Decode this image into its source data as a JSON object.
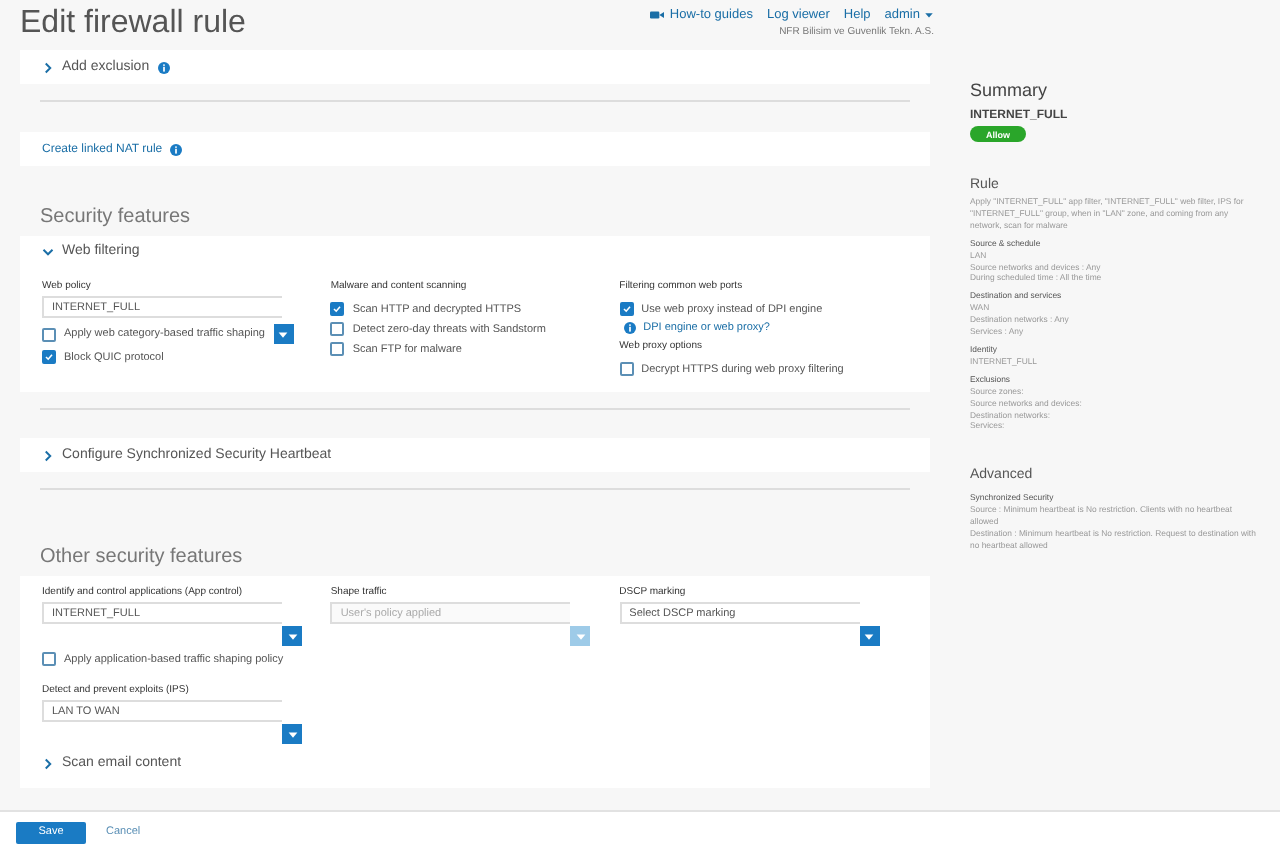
{
  "header": {
    "title": "Edit firewall rule",
    "links": [
      "How-to guides",
      "Log viewer",
      "Help"
    ],
    "user": "admin",
    "company": "NFR Bilisim ve Guvenlik Tekn. A.S."
  },
  "exclusion": {
    "label": "Add exclusion",
    "expanded": false
  },
  "nat": {
    "label": "Create linked NAT rule"
  },
  "security": {
    "heading": "Security features",
    "web_filtering": {
      "label": "Web filtering",
      "expanded": true,
      "web_policy": {
        "label": "Web policy",
        "value": "INTERNET_FULL"
      },
      "left_options": [
        {
          "label": "Apply web category-based traffic shaping",
          "checked": false,
          "dropdown": true
        },
        {
          "label": "Block QUIC protocol",
          "checked": true,
          "dropdown": false
        }
      ],
      "malware": {
        "label": "Malware and content scanning",
        "options": [
          {
            "label": "Scan HTTP and decrypted HTTPS",
            "checked": true
          },
          {
            "label": "Detect zero-day threats with Sandstorm",
            "checked": false
          },
          {
            "label": "Scan FTP for malware",
            "checked": false
          }
        ]
      },
      "ports": {
        "label": "Filtering common web ports",
        "option": {
          "label": "Use web proxy instead of DPI engine",
          "checked": true
        },
        "link": "DPI engine or web proxy?"
      },
      "proxy": {
        "label": "Web proxy options",
        "option": {
          "label": "Decrypt HTTPS during web proxy filtering",
          "checked": false
        }
      }
    },
    "heartbeat": {
      "label": "Configure Synchronized Security Heartbeat",
      "expanded": false
    }
  },
  "other": {
    "heading": "Other security features",
    "app_control": {
      "label": "Identify and control applications (App control)",
      "value": "INTERNET_FULL",
      "disabled": false
    },
    "shape_traffic": {
      "label": "Shape traffic",
      "placeholder": "User's policy applied",
      "disabled": true
    },
    "dscp": {
      "label": "DSCP marking",
      "value": "Select DSCP marking",
      "disabled": false
    },
    "app_shaping": {
      "label": "Apply application-based traffic shaping policy",
      "checked": false
    },
    "ips": {
      "label": "Detect and prevent exploits (IPS)",
      "value": "LAN TO WAN",
      "disabled": false
    },
    "email": {
      "label": "Scan email content",
      "expanded": false
    }
  },
  "footer": {
    "buttons": [
      "Save",
      "Cancel"
    ]
  },
  "summary": {
    "heading": "Summary",
    "rule_name": "INTERNET_FULL",
    "action": "Allow",
    "rule_heading": "Rule",
    "rule_text": "Apply \"INTERNET_FULL\" app filter, \"INTERNET_FULL\" web filter, IPS for \"INTERNET_FULL\" group, when in \"LAN\" zone, and coming from any network, scan for malware",
    "sections": [
      {
        "title": "Source & schedule",
        "lines": [
          "LAN",
          "Source networks and devices : Any",
          "During scheduled time : All the time"
        ]
      },
      {
        "title": "Destination and services",
        "lines": [
          "WAN",
          "Destination networks : Any",
          "Services : Any"
        ]
      },
      {
        "title": "Identity",
        "lines": [
          "INTERNET_FULL"
        ]
      },
      {
        "title": "Exclusions",
        "lines": [
          "Source zones:",
          "Source networks and devices:",
          "Destination networks:",
          "Services:"
        ]
      }
    ],
    "advanced_heading": "Advanced",
    "advanced_title": "Synchronized Security",
    "advanced_lines": [
      "Source : Minimum heartbeat is No restriction. Clients with no heartbeat allowed",
      "Destination : Minimum heartbeat is No restriction. Request to destination with no heartbeat allowed"
    ]
  }
}
